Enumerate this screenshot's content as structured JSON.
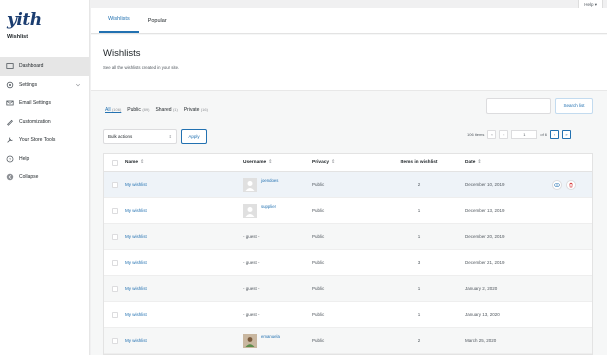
{
  "topbar": {
    "help_label": "Help ▾"
  },
  "brand": {
    "logo_text": "yith",
    "subtitle": "Wishlist"
  },
  "sidebar": {
    "items": [
      {
        "label": "Dashboard",
        "icon": "dashboard-icon",
        "active": true
      },
      {
        "label": "Settings",
        "icon": "gear-icon",
        "has_children": true
      },
      {
        "label": "Email Settings",
        "icon": "email-icon"
      },
      {
        "label": "Customization",
        "icon": "brush-icon"
      },
      {
        "label": "Your Store Tools",
        "icon": "store-tools-icon"
      },
      {
        "label": "Help",
        "icon": "help-icon"
      },
      {
        "label": "Collapse",
        "icon": "collapse-icon"
      }
    ]
  },
  "tabs": [
    {
      "label": "Wishlists",
      "active": true
    },
    {
      "label": "Popular",
      "active": false
    }
  ],
  "page": {
    "title": "Wishlists",
    "description": "See all the wishlists created in your site."
  },
  "filters": [
    {
      "label": "All",
      "count": "(106)",
      "active": true
    },
    {
      "label": "Public",
      "count": "(89)",
      "active": false
    },
    {
      "label": "Shared",
      "count": "(1)",
      "active": false
    },
    {
      "label": "Private",
      "count": "(16)",
      "active": false
    }
  ],
  "search": {
    "placeholder": "",
    "button_label": "Search list"
  },
  "bulk": {
    "selected": "Bulk actions",
    "apply_label": "Apply"
  },
  "pagination": {
    "items_text": "106 items",
    "first": "«",
    "prev": "‹",
    "current_page": "1",
    "of_text": "of 6",
    "next": "›",
    "last": "»"
  },
  "table": {
    "headers": {
      "name": "Name",
      "username": "Username",
      "privacy": "Privacy",
      "items": "Items in wishlist",
      "date": "Date",
      "sort_glyph": "⇕"
    },
    "rows": [
      {
        "name": "My wishlist",
        "username": "joendoes",
        "avatar": "placeholder",
        "privacy": "Public",
        "items": "2",
        "date": "December 10, 2019",
        "show_actions": true
      },
      {
        "name": "My wishlist",
        "username": "supplier",
        "avatar": "placeholder",
        "privacy": "Public",
        "items": "1",
        "date": "December 13, 2019"
      },
      {
        "name": "My wishlist",
        "username": "- guest -",
        "avatar": "",
        "privacy": "Public",
        "items": "1",
        "date": "December 20, 2019"
      },
      {
        "name": "My wishlist",
        "username": "- guest -",
        "avatar": "",
        "privacy": "Public",
        "items": "3",
        "date": "December 21, 2019"
      },
      {
        "name": "My wishlist",
        "username": "- guest -",
        "avatar": "",
        "privacy": "Public",
        "items": "1",
        "date": "January 2, 2020"
      },
      {
        "name": "My wishlist",
        "username": "- guest -",
        "avatar": "",
        "privacy": "Public",
        "items": "1",
        "date": "January 13, 2020"
      },
      {
        "name": "My wishlist",
        "username": "emanuela",
        "avatar": "photo",
        "privacy": "Public",
        "items": "2",
        "date": "March 25, 2020"
      }
    ]
  },
  "colors": {
    "accent": "#2271b1",
    "delete": "#d63638",
    "logo": "#1b3d70"
  }
}
